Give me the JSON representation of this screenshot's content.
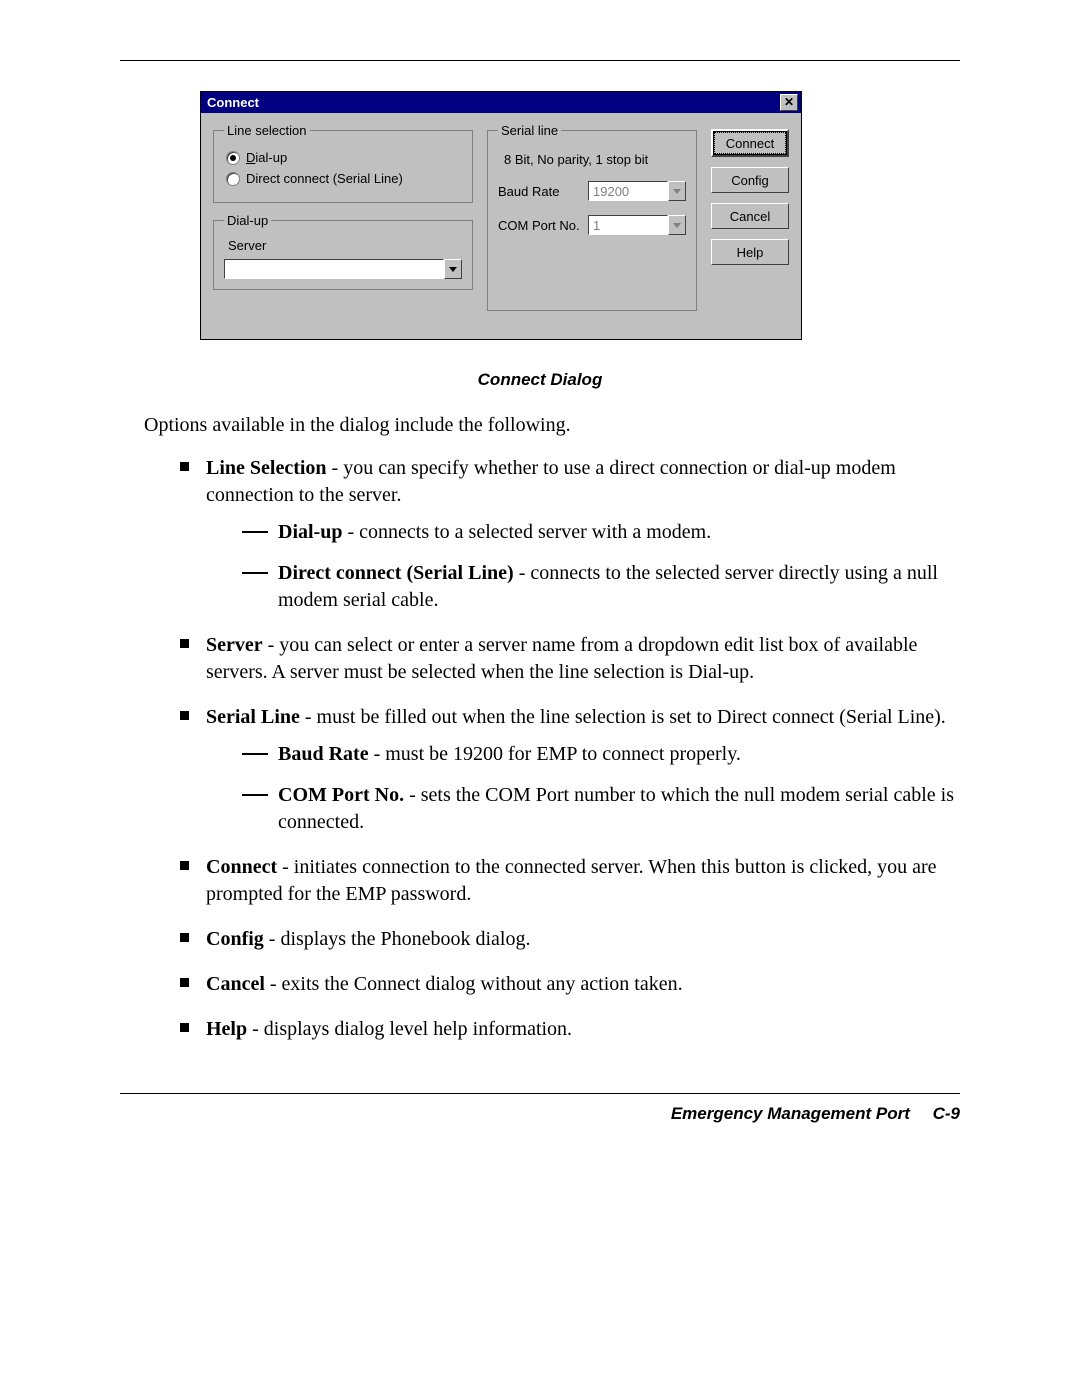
{
  "dialog": {
    "title": "Connect",
    "close_glyph": "✕",
    "line_selection": {
      "legend": "Line selection",
      "dialup_label": "Dial-up",
      "direct_label": "Direct connect (Serial Line)"
    },
    "dialup_group": {
      "legend": "Dial-up",
      "server_label": "Server"
    },
    "serial": {
      "legend": "Serial line",
      "info": "8 Bit, No parity, 1 stop bit",
      "baud_label": "Baud Rate",
      "baud_value": "19200",
      "com_label": "COM Port No.",
      "com_value": "1"
    },
    "buttons": {
      "connect": "Connect",
      "config": "Config",
      "cancel": "Cancel",
      "help": "Help"
    }
  },
  "caption": "Connect Dialog",
  "intro": "Options available in the dialog include the following.",
  "items": {
    "line_sel_lead": "Line Selection",
    "line_sel_rest": " - you can specify whether to use a direct connection or dial-up modem connection to the server.",
    "dialup_lead": "Dial-up",
    "dialup_rest": " - connects to a selected server with a modem.",
    "direct_lead": "Direct connect (Serial Line)",
    "direct_rest": " - connects to the selected server directly using a null modem serial cable.",
    "server_lead": "Server",
    "server_rest": " - you can select or enter a server name from a dropdown edit list box of available servers. A server must be selected when the line selection is Dial-up.",
    "serial_lead": "Serial Line",
    "serial_rest": " - must be filled out when the line selection is set to Direct connect (Serial Line).",
    "baud_lead": "Baud Rate",
    "baud_rest": " - must be 19200 for EMP to connect properly.",
    "com_lead": "COM Port No.",
    "com_rest": " - sets the COM Port number to which the null modem serial cable is connected.",
    "connect_lead": "Connect",
    "connect_rest": " - initiates connection to the connected server. When this button is clicked, you are prompted for the EMP password.",
    "config_lead": "Config",
    "config_rest": " - displays the Phonebook dialog.",
    "cancel_lead": "Cancel",
    "cancel_rest": " - exits the Connect dialog without any action taken.",
    "help_lead": "Help",
    "help_rest": " - displays dialog level help information."
  },
  "footer": {
    "section": "Emergency Management Port",
    "page": "C-9"
  }
}
